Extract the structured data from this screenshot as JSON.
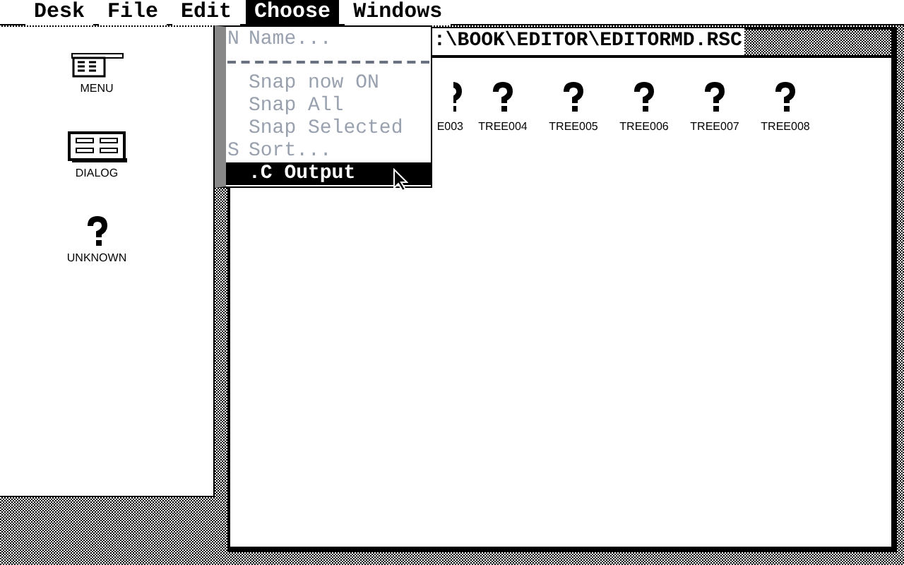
{
  "menu_bar": [
    {
      "label": "Desk",
      "selected": false
    },
    {
      "label": "File",
      "selected": false
    },
    {
      "label": "Edit",
      "selected": false
    },
    {
      "label": "Choose",
      "selected": true
    },
    {
      "label": "Windows",
      "selected": false
    }
  ],
  "dropdown": {
    "items": [
      {
        "kind": "item",
        "shortcut": "N",
        "label": "Name...",
        "disabled": true,
        "selected": false
      },
      {
        "kind": "separator"
      },
      {
        "kind": "item",
        "label": "Snap now ON",
        "disabled": true,
        "selected": false
      },
      {
        "kind": "item",
        "label": "Snap All",
        "disabled": true,
        "selected": false
      },
      {
        "kind": "item",
        "label": "Snap Selected",
        "disabled": true,
        "selected": false
      },
      {
        "kind": "item",
        "shortcut": "S",
        "label": "Sort...",
        "disabled": true,
        "selected": false
      },
      {
        "kind": "item",
        "label": ".C Output",
        "disabled": false,
        "selected": true
      }
    ]
  },
  "left_panel": {
    "icons": [
      {
        "kind": "menu",
        "label": "MENU"
      },
      {
        "kind": "dialog",
        "label": "DIALOG"
      },
      {
        "kind": "unknown",
        "label": "UNKNOWN"
      }
    ]
  },
  "window": {
    "title": ":\\BOOK\\EDITOR\\EDITORMD.RSC",
    "trees": [
      {
        "label": "E003",
        "partial": true
      },
      {
        "label": "TREE004",
        "partial": false
      },
      {
        "label": "TREE005",
        "partial": false
      },
      {
        "label": "TREE006",
        "partial": false
      },
      {
        "label": "TREE007",
        "partial": false
      },
      {
        "label": "TREE008",
        "partial": false
      }
    ]
  }
}
